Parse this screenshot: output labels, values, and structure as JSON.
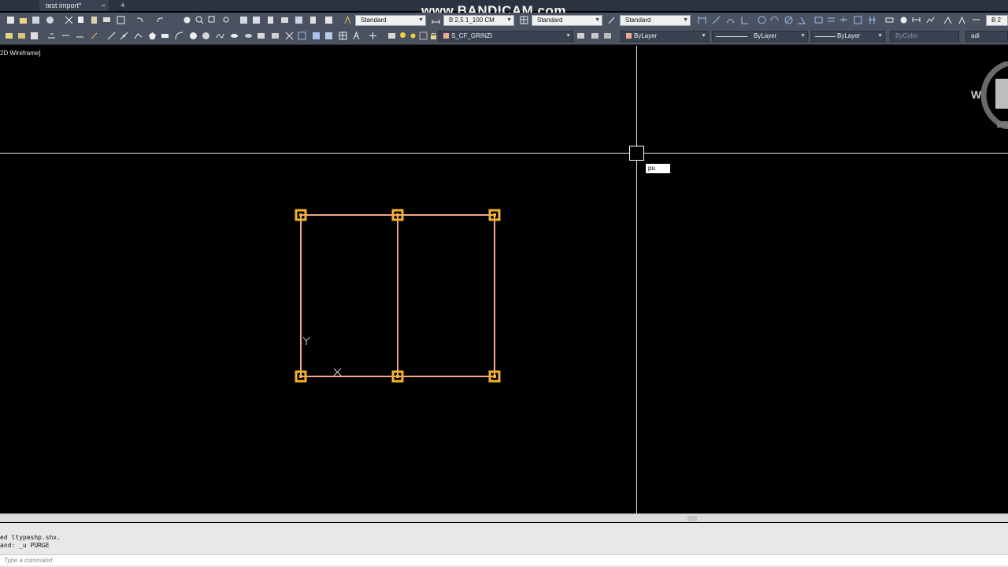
{
  "title_bar": {
    "tab_label": "test import*",
    "tab_close": "×",
    "tab_add": "+"
  },
  "watermark": "www.BANDICAM.com",
  "toolbar1": {
    "text_style": "Standard",
    "dim_style": "B 2.5 1_100 CM",
    "table_style": "Standard",
    "multileader_style": "Standard",
    "right_text": "B 2"
  },
  "toolbar2": {
    "layer": "S_CF_GRINZI",
    "color": "ByLayer",
    "linetype": "ByLayer",
    "lineweight": "ByLayer",
    "plotstyle": "ByColor",
    "extra": "adi"
  },
  "viewport": {
    "label": "2D Wireframe]",
    "dynamic_input": "pu",
    "viewcube_letter": "W"
  },
  "command_history": [
    "ed ltypeshp.shx.",
    "and: _u PURGE"
  ],
  "command_input": {
    "placeholder": "Type a command"
  },
  "colors": {
    "selected_lines": "#f0a890",
    "grips": "#f5b226",
    "background": "#000000"
  }
}
